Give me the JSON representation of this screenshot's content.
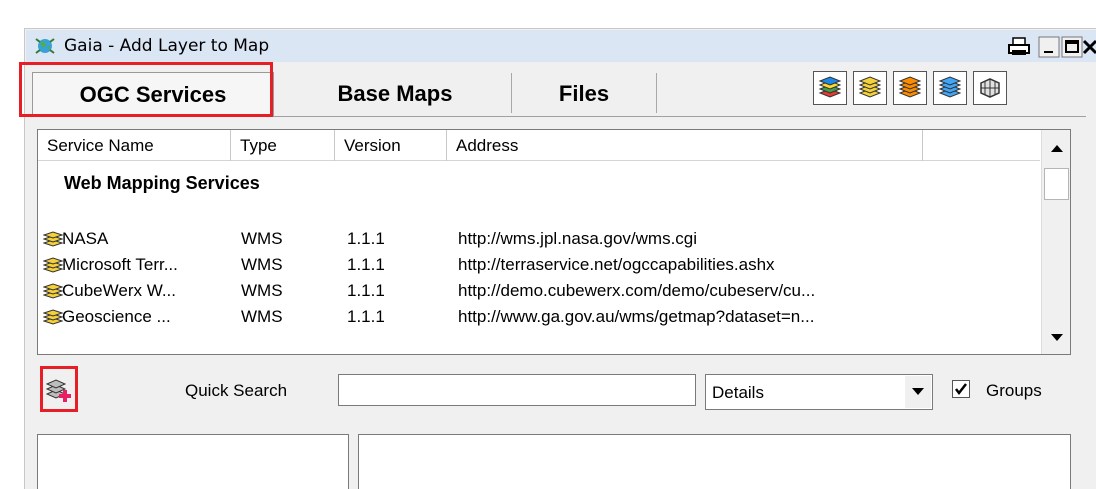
{
  "window": {
    "title": "Gaia - Add Layer to Map"
  },
  "titlebar_buttons": [
    "printer-icon",
    "minimize-icon",
    "maximize-icon",
    "close-icon"
  ],
  "tabs": [
    {
      "label": "OGC Services",
      "active": true
    },
    {
      "label": "Base Maps",
      "active": false
    },
    {
      "label": "Files",
      "active": false
    }
  ],
  "view_mode_buttons": [
    "layers-multicolor-icon",
    "layers-yellow-icon",
    "layers-orange-icon",
    "layers-blue-icon",
    "layers-grid-icon"
  ],
  "list": {
    "columns": [
      "Service Name",
      "Type",
      "Version",
      "Address"
    ],
    "group": "Web Mapping Services",
    "rows": [
      {
        "name": "NASA",
        "type": "WMS",
        "version": "1.1.1",
        "address": "http://wms.jpl.nasa.gov/wms.cgi"
      },
      {
        "name": "Microsoft Terr...",
        "type": "WMS",
        "version": "1.1.1",
        "address": "http://terraservice.net/ogccapabilities.ashx"
      },
      {
        "name": "CubeWerx W...",
        "type": "WMS",
        "version": "1.1.1",
        "address": "http://demo.cubewerx.com/demo/cubeserv/cu..."
      },
      {
        "name": "Geoscience ...",
        "type": "WMS",
        "version": "1.1.1",
        "address": "http://www.ga.gov.au/wms/getmap?dataset=n..."
      }
    ]
  },
  "search": {
    "label": "Quick Search",
    "value": ""
  },
  "view_select": {
    "value": "Details"
  },
  "groups_checkbox": {
    "label": "Groups",
    "checked": true
  },
  "colors": {
    "highlight": "#e51f25",
    "titlebar": "#dbe6f4",
    "window_bg": "#f0f0f0"
  }
}
